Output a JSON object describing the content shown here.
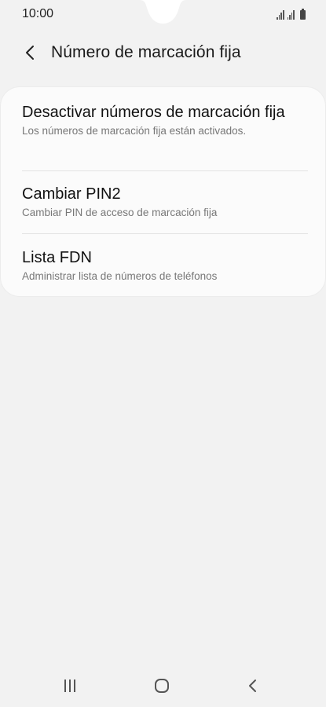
{
  "status_bar": {
    "time": "10:00",
    "icons": [
      "signal-icon",
      "signal-icon",
      "battery-icon"
    ]
  },
  "header": {
    "back_icon": "chevron-left-icon",
    "title": "Número de marcación fija"
  },
  "settings": {
    "items": [
      {
        "title": "Desactivar números de marcación fija",
        "subtitle": "Los números de marcación fija están activados."
      },
      {
        "title": "Cambiar PIN2",
        "subtitle": "Cambiar PIN de acceso de marcación fija"
      },
      {
        "title": "Lista FDN",
        "subtitle": "Administrar lista de números de teléfonos"
      }
    ]
  },
  "nav_bar": {
    "buttons": [
      "recent-apps-icon",
      "home-icon",
      "back-icon"
    ]
  },
  "colors": {
    "background": "#f2f2f2",
    "card": "#fbfbfb",
    "text": "#111111",
    "subtext": "#777777"
  }
}
